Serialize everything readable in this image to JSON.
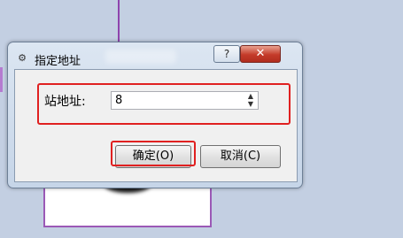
{
  "dialog": {
    "title": "指定地址",
    "window_icon": "gear-icon",
    "help_label": "?",
    "close_label": "✕",
    "station_label": "站地址:",
    "station_value": "8",
    "ok_label": "确定(O)",
    "cancel_label": "取消(C)"
  },
  "colors": {
    "highlight": "#e02020",
    "background": "#c3cfe2"
  }
}
